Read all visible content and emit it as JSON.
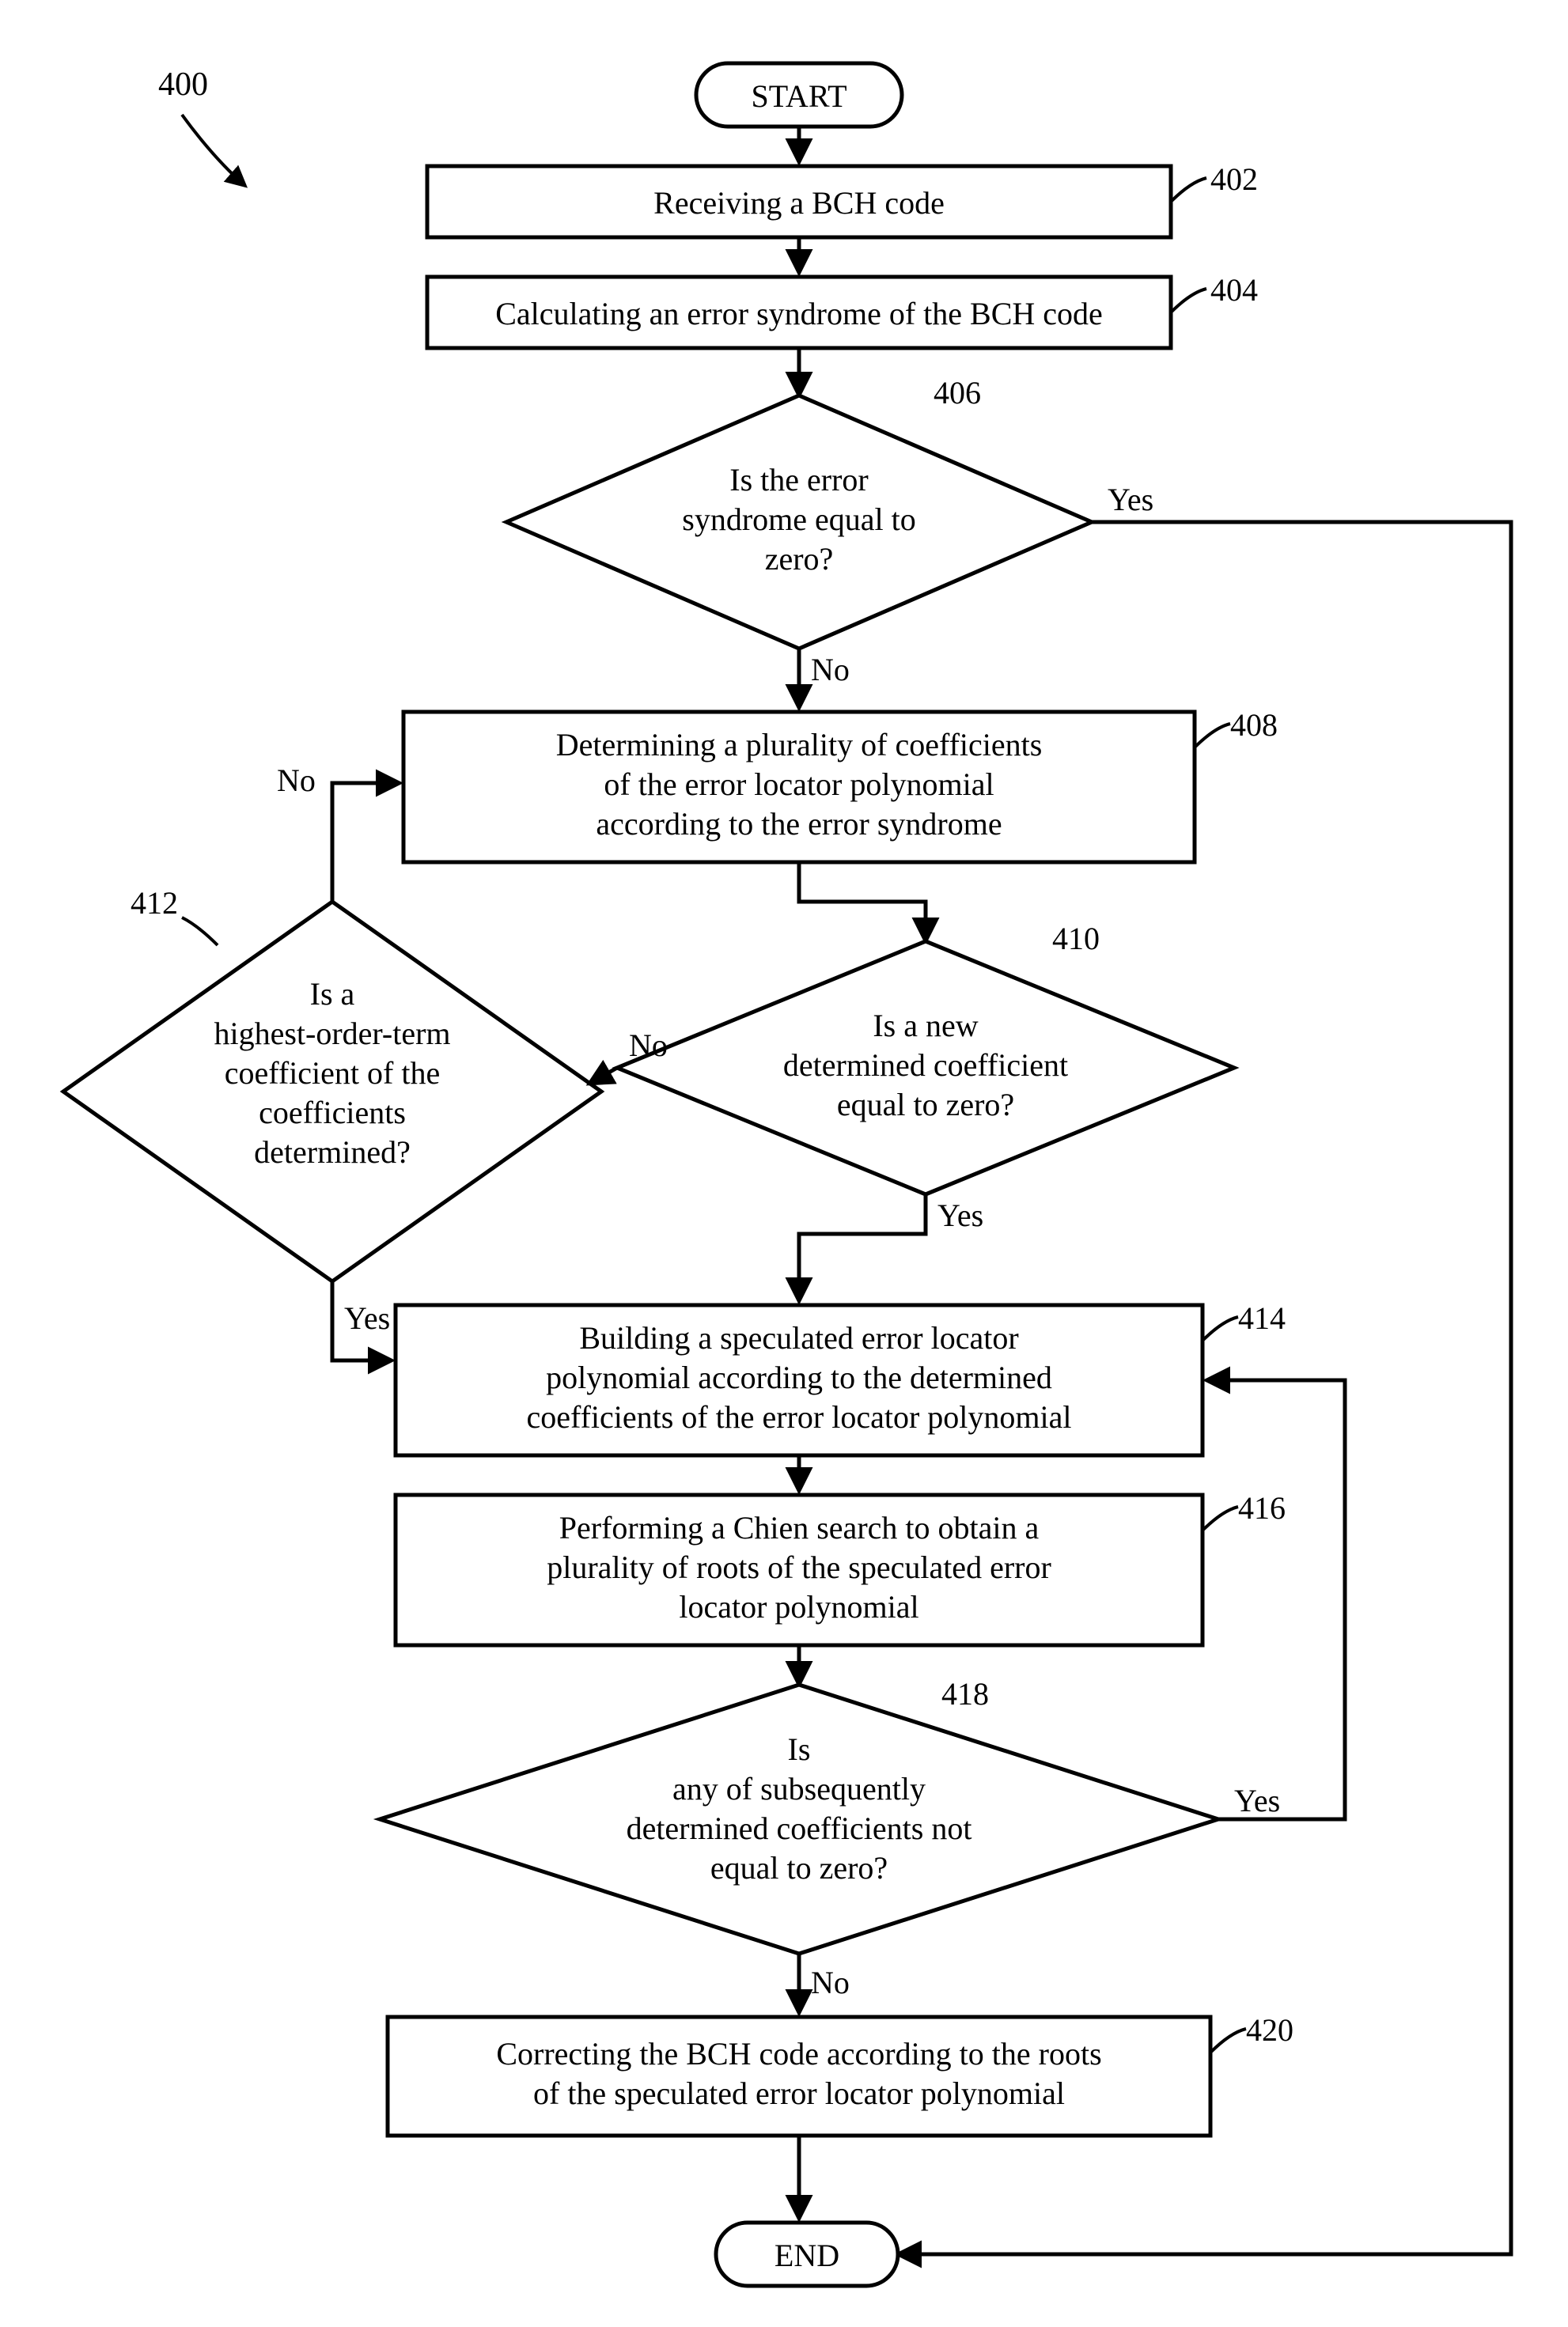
{
  "figure": {
    "label": "400"
  },
  "terminals": {
    "start": "START",
    "end": "END"
  },
  "boxes": {
    "b402": {
      "ref": "402",
      "lines": [
        "Receiving a BCH code"
      ]
    },
    "b404": {
      "ref": "404",
      "lines": [
        "Calculating an error syndrome of the BCH code"
      ]
    },
    "b408": {
      "ref": "408",
      "lines": [
        "Determining a plurality of coefficients",
        "of the error locator polynomial",
        "according to the error syndrome"
      ]
    },
    "b414": {
      "ref": "414",
      "lines": [
        "Building a speculated error locator",
        "polynomial according to the determined",
        "coefficients of the error locator polynomial"
      ]
    },
    "b416": {
      "ref": "416",
      "lines": [
        "Performing a Chien search to obtain a",
        "plurality of roots of the speculated error",
        "locator polynomial"
      ]
    },
    "b420": {
      "ref": "420",
      "lines": [
        "Correcting the BCH code according to the roots",
        "of the speculated error locator polynomial"
      ]
    }
  },
  "decisions": {
    "d406": {
      "ref": "406",
      "lines": [
        "Is the error",
        "syndrome equal to",
        "zero?"
      ]
    },
    "d410": {
      "ref": "410",
      "lines": [
        "Is a new",
        "determined coefficient",
        "equal to zero?"
      ]
    },
    "d412": {
      "ref": "412",
      "lines": [
        "Is a",
        "highest-order-term",
        "coefficient of the",
        "coefficients",
        "determined?"
      ]
    },
    "d418": {
      "ref": "418",
      "lines": [
        "Is",
        "any of subsequently",
        "determined coefficients not",
        "equal to zero?"
      ]
    }
  },
  "labels": {
    "yes": "Yes",
    "no": "No"
  },
  "chart_data": {
    "type": "flowchart",
    "title": "BCH code error correction flow (figure 400)",
    "nodes": [
      {
        "id": "start",
        "type": "terminal",
        "text": "START"
      },
      {
        "id": "402",
        "type": "process",
        "text": "Receiving a BCH code"
      },
      {
        "id": "404",
        "type": "process",
        "text": "Calculating an error syndrome of the BCH code"
      },
      {
        "id": "406",
        "type": "decision",
        "text": "Is the error syndrome equal to zero?"
      },
      {
        "id": "408",
        "type": "process",
        "text": "Determining a plurality of coefficients of the error locator polynomial according to the error syndrome"
      },
      {
        "id": "410",
        "type": "decision",
        "text": "Is a new determined coefficient equal to zero?"
      },
      {
        "id": "412",
        "type": "decision",
        "text": "Is a highest-order-term coefficient of the coefficients determined?"
      },
      {
        "id": "414",
        "type": "process",
        "text": "Building a speculated error locator polynomial according to the determined coefficients of the error locator polynomial"
      },
      {
        "id": "416",
        "type": "process",
        "text": "Performing a Chien search to obtain a plurality of roots of the speculated error locator polynomial"
      },
      {
        "id": "418",
        "type": "decision",
        "text": "Is any of subsequently determined coefficients not equal to zero?"
      },
      {
        "id": "420",
        "type": "process",
        "text": "Correcting the BCH code according to the roots of the speculated error locator polynomial"
      },
      {
        "id": "end",
        "type": "terminal",
        "text": "END"
      }
    ],
    "edges": [
      {
        "from": "start",
        "to": "402"
      },
      {
        "from": "402",
        "to": "404"
      },
      {
        "from": "404",
        "to": "406"
      },
      {
        "from": "406",
        "to": "end",
        "label": "Yes"
      },
      {
        "from": "406",
        "to": "408",
        "label": "No"
      },
      {
        "from": "408",
        "to": "410"
      },
      {
        "from": "410",
        "to": "412",
        "label": "No"
      },
      {
        "from": "410",
        "to": "414",
        "label": "Yes"
      },
      {
        "from": "412",
        "to": "408",
        "label": "No"
      },
      {
        "from": "412",
        "to": "414",
        "label": "Yes"
      },
      {
        "from": "414",
        "to": "416"
      },
      {
        "from": "416",
        "to": "418"
      },
      {
        "from": "418",
        "to": "414",
        "label": "Yes"
      },
      {
        "from": "418",
        "to": "420",
        "label": "No"
      },
      {
        "from": "420",
        "to": "end"
      }
    ]
  }
}
